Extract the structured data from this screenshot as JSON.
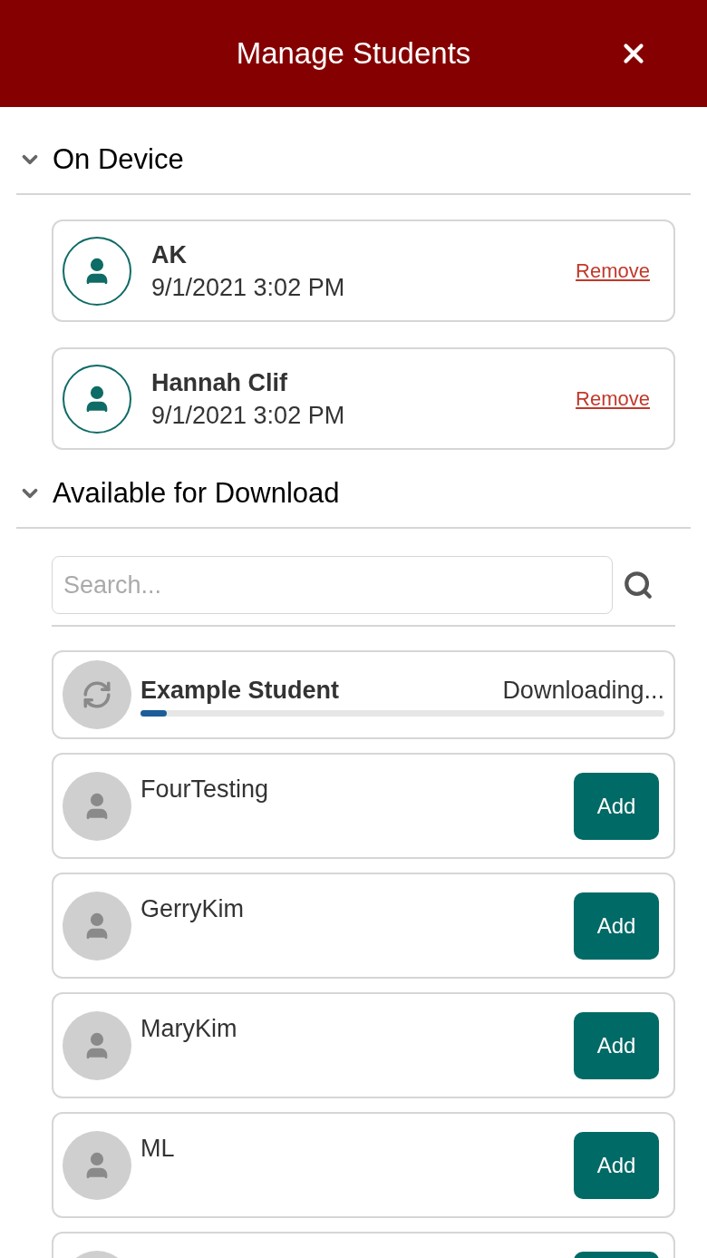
{
  "header": {
    "title": "Manage Students"
  },
  "sections": [
    {
      "title": "On Device",
      "expanded": true,
      "kind": "device",
      "students": [
        {
          "name": "AK",
          "date": "9/1/2021 3:02 PM",
          "action": "Remove"
        },
        {
          "name": "Hannah Clif",
          "date": "9/1/2021 3:02 PM",
          "action": "Remove"
        }
      ]
    },
    {
      "title": "Available for Download",
      "expanded": true,
      "kind": "download",
      "search": {
        "placeholder": "Search..."
      },
      "students": [
        {
          "kind": "downloading",
          "name": "Example Student",
          "status": "Downloading...",
          "level": 0.05
        },
        {
          "kind": "available",
          "name": "FourTesting",
          "action": "Add"
        },
        {
          "kind": "available",
          "name": "GerryKim",
          "action": "Add"
        },
        {
          "kind": "available",
          "name": "MaryKim",
          "action": "Add"
        },
        {
          "kind": "available",
          "name": "ML",
          "action": "Add"
        },
        {
          "kind": "cut_off"
        }
      ]
    }
  ]
}
